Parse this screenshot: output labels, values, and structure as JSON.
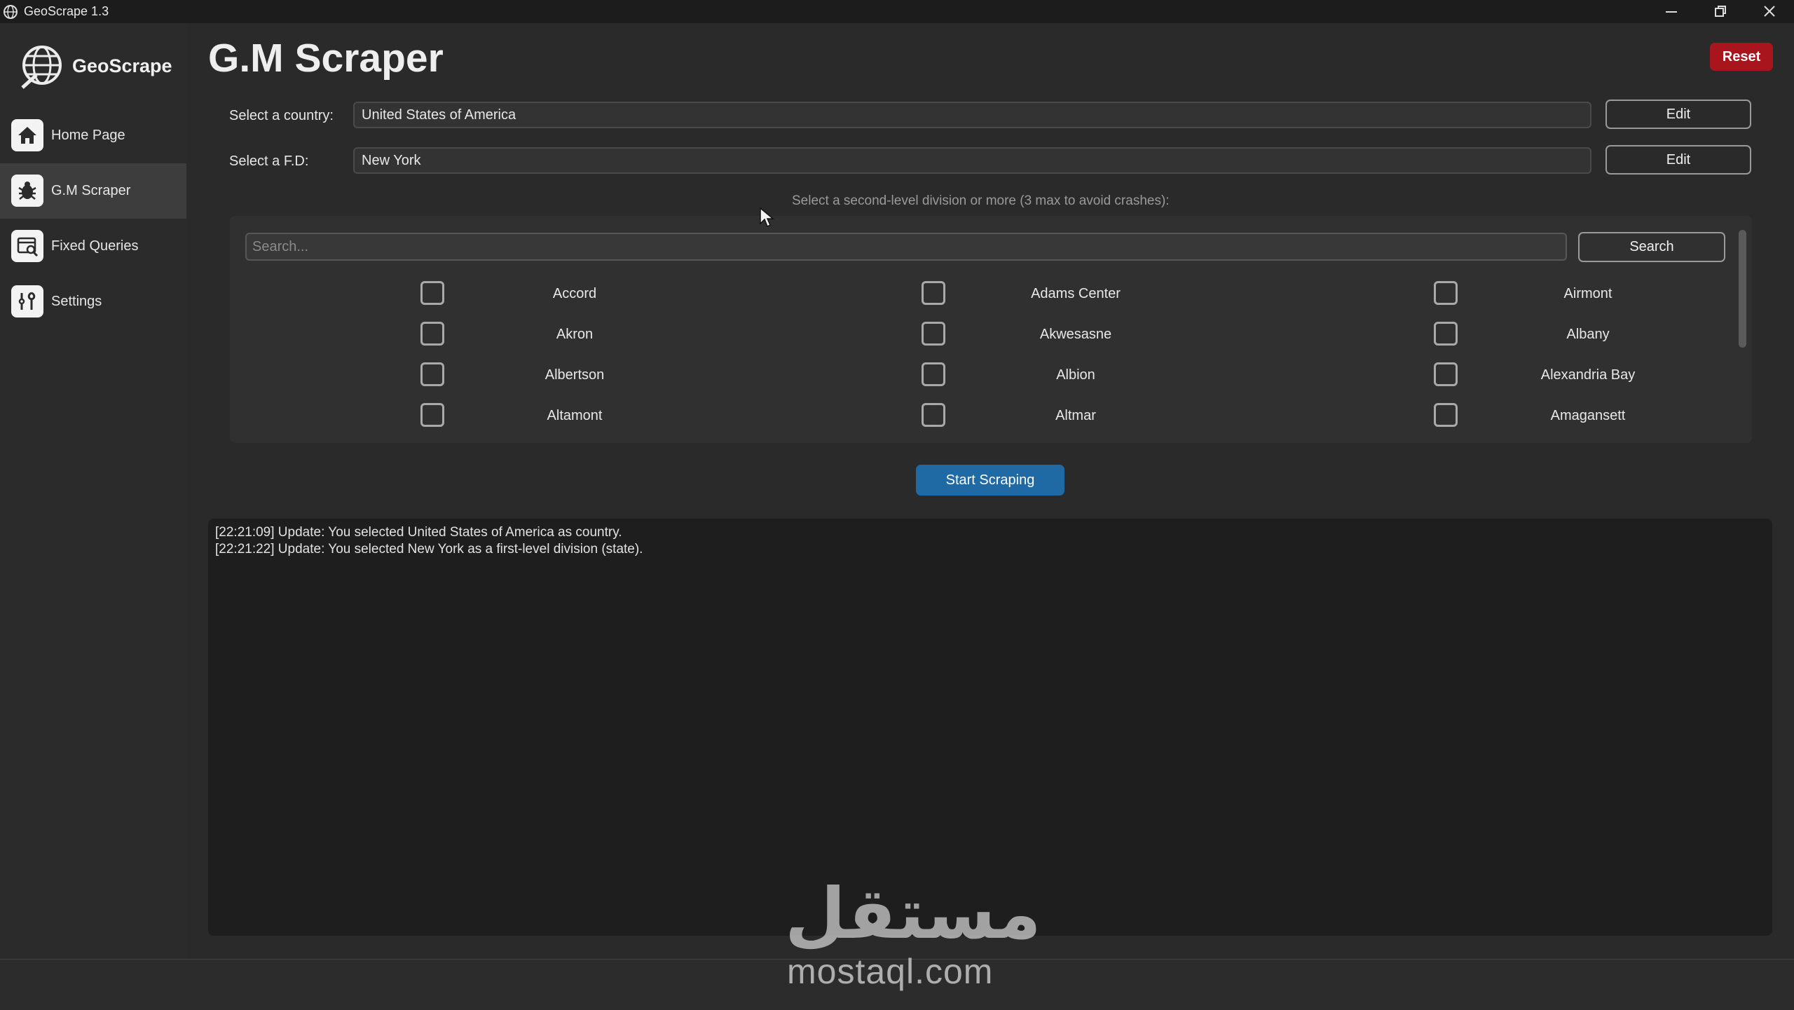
{
  "window": {
    "title": "GeoScrape 1.3"
  },
  "sidebar": {
    "brand": "GeoScrape",
    "items": [
      {
        "label": "Home Page",
        "icon": "home-icon"
      },
      {
        "label": "G.M Scraper",
        "icon": "bug-icon",
        "active": true
      },
      {
        "label": "Fixed Queries",
        "icon": "query-icon"
      },
      {
        "label": "Settings",
        "icon": "tools-icon"
      }
    ]
  },
  "main": {
    "title": "G.M Scraper",
    "reset_label": "Reset",
    "country": {
      "label": "Select a country:",
      "value": "United States of America",
      "edit_label": "Edit"
    },
    "fd": {
      "label": "Select a F.D:",
      "value": "New York",
      "edit_label": "Edit"
    },
    "hint": "Select a second-level division or more (3 max to avoid crashes):",
    "search": {
      "placeholder": "Search...",
      "button_label": "Search"
    },
    "divisions": [
      "Accord",
      "Adams Center",
      "Airmont",
      "Akron",
      "Akwesasne",
      "Albany",
      "Albertson",
      "Albion",
      "Alexandria Bay",
      "Altamont",
      "Altmar",
      "Amagansett"
    ],
    "start_label": "Start Scraping",
    "log": [
      "[22:21:09] Update: You selected United States of America as country.",
      "[22:21:22] Update: You selected New York as a first-level division (state)."
    ]
  },
  "watermark": {
    "arabic": "مستقل",
    "latin": "mostaql.com"
  },
  "colors": {
    "accent": "#1f6aa5",
    "danger": "#a8151d",
    "background": "#2a2a2a"
  }
}
